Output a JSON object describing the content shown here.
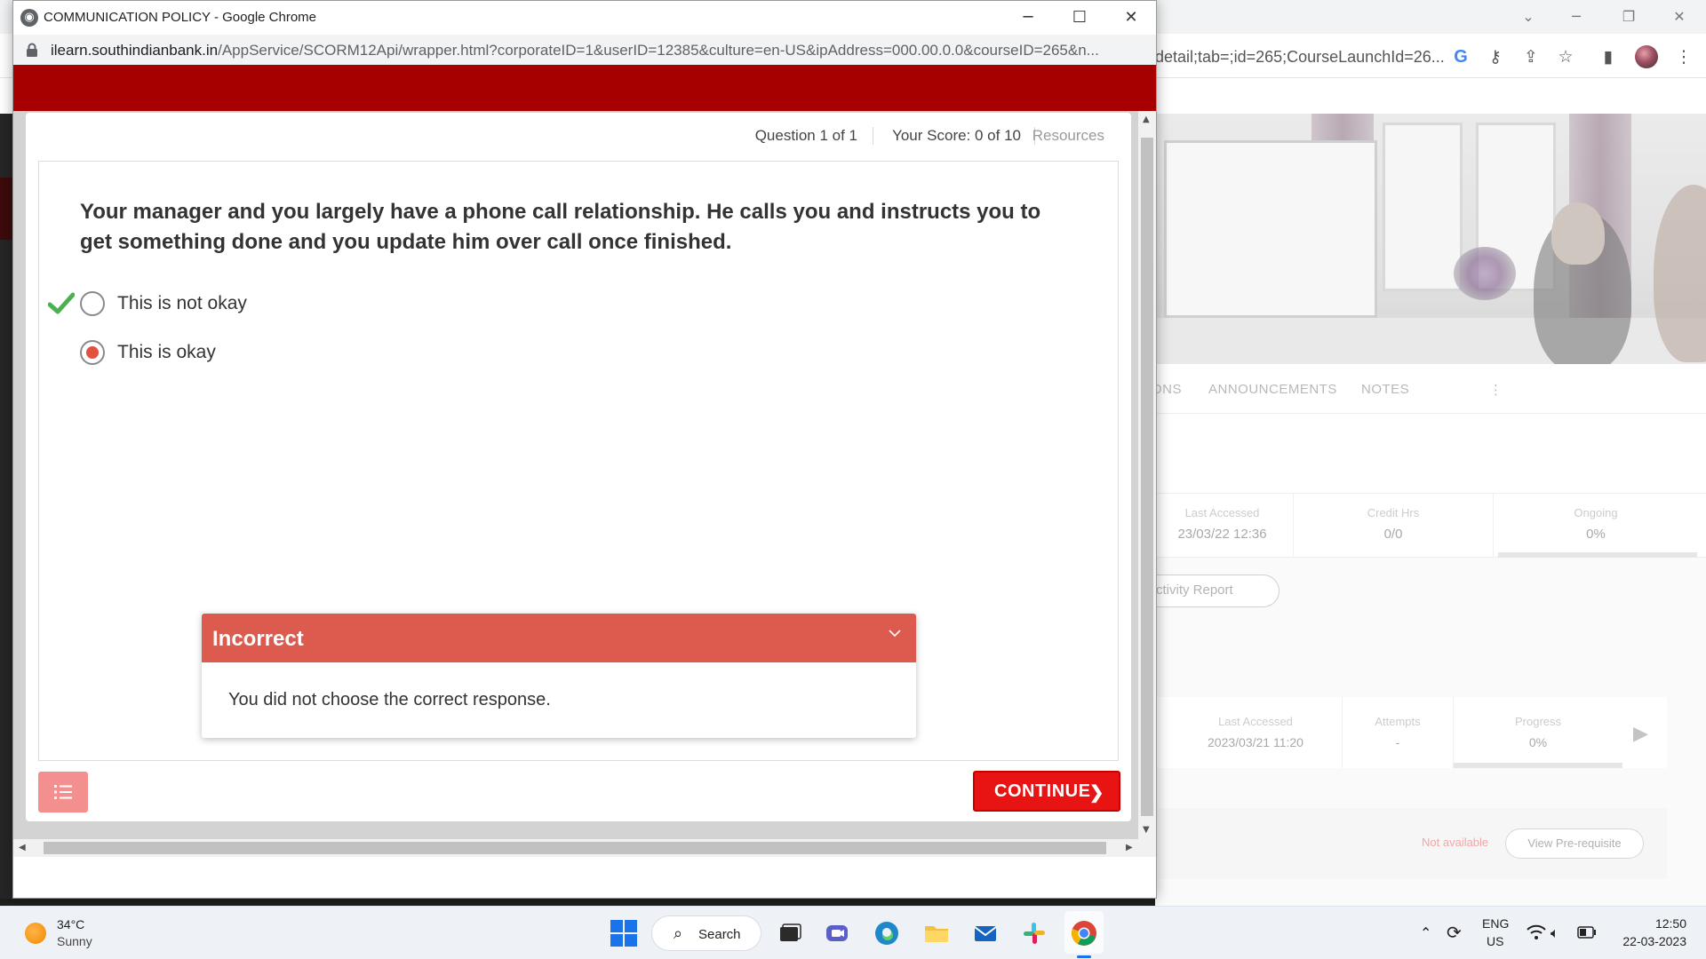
{
  "popup": {
    "window_title": "COMMUNICATION POLICY - Google Chrome",
    "url_host": "ilearn.southindianbank.in",
    "url_path": "/AppService/SCORM12Api/wrapper.html?corporateID=1&userID=12385&culture=en-US&ipAddress=000.00.0.0&courseID=265&n..."
  },
  "quiz": {
    "question_counter": "Question 1 of 1",
    "score": "Your Score: 0 of 10",
    "resources_label": "Resources",
    "question_text": "Your manager and you largely have a phone call relationship. He calls you and instructs you to get something done and you update him over call once finished.",
    "choices": [
      {
        "label": "This is not okay",
        "selected": false,
        "correct": true
      },
      {
        "label": "This is okay",
        "selected": true,
        "correct": false
      }
    ],
    "feedback_title": "Incorrect",
    "feedback_body": "You did not choose the correct response.",
    "continue_label": "CONTINUE",
    "accent_color": "#dc5b4e",
    "button_color": "#e81414",
    "banner_color": "#a60000"
  },
  "background_page": {
    "url_fragment": "detail;tab=;id=265;CourseLaunchId=26...",
    "tabs": [
      "ONS",
      "ANNOUNCEMENTS",
      "NOTES"
    ],
    "stats_top": [
      {
        "label": "Last Accessed",
        "value": "23/03/22 12:36"
      },
      {
        "label": "Credit Hrs",
        "value": "0/0"
      },
      {
        "label": "Ongoing",
        "value": "0%"
      }
    ],
    "activity_report_label": "ctivity Report",
    "stats_bottom": [
      {
        "label": "Last Accessed",
        "value": "2023/03/21 11:20"
      },
      {
        "label": "Attempts",
        "value": "-"
      },
      {
        "label": "Progress",
        "value": "0%"
      }
    ],
    "not_available": "Not available",
    "view_prereq_label": "View Pre-requisite"
  },
  "taskbar": {
    "temperature": "34°C",
    "condition": "Sunny",
    "search_label": "Search",
    "lang_line1": "ENG",
    "lang_line2": "US",
    "time": "12:50",
    "date": "22-03-2023"
  }
}
